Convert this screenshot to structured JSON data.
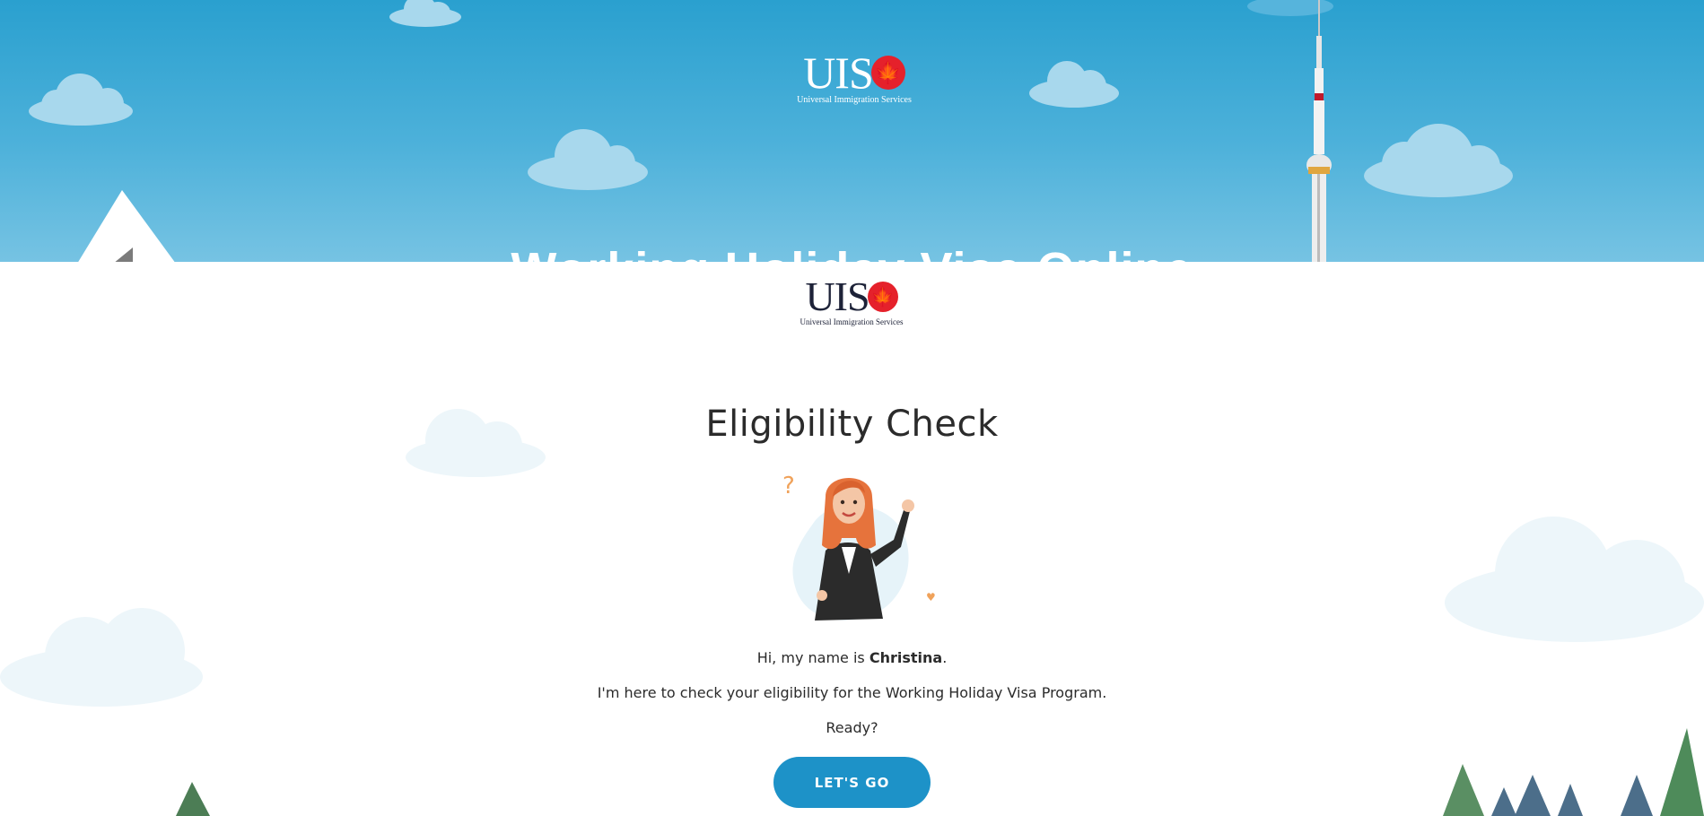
{
  "hero": {
    "brand": {
      "wordmark": "UIS",
      "maple_icon": "maple-leaf-icon",
      "tagline": "Universal Immigration Services"
    },
    "title": "Working Holiday Visa Online"
  },
  "modal": {
    "brand": {
      "wordmark": "UIS",
      "maple_icon": "maple-leaf-icon",
      "tagline": "Universal Immigration Services"
    },
    "title": "Eligibility Check",
    "avatar_icon": "agent-avatar-illustration",
    "greeting_prefix": "Hi, my name is ",
    "agent_name": "Christina",
    "greeting_suffix": ".",
    "intro": "I'm here to check your eligibility for the Working Holiday Visa Program.",
    "prompt": "Ready?",
    "cta_label": "LET'S GO"
  },
  "colors": {
    "sky_top": "#2aa0cf",
    "sky_bottom": "#76c3e3",
    "accent_button": "#1d92c8",
    "brand_red": "#e5212b",
    "brand_navy": "#1d2238",
    "text": "#2b2b2b"
  }
}
